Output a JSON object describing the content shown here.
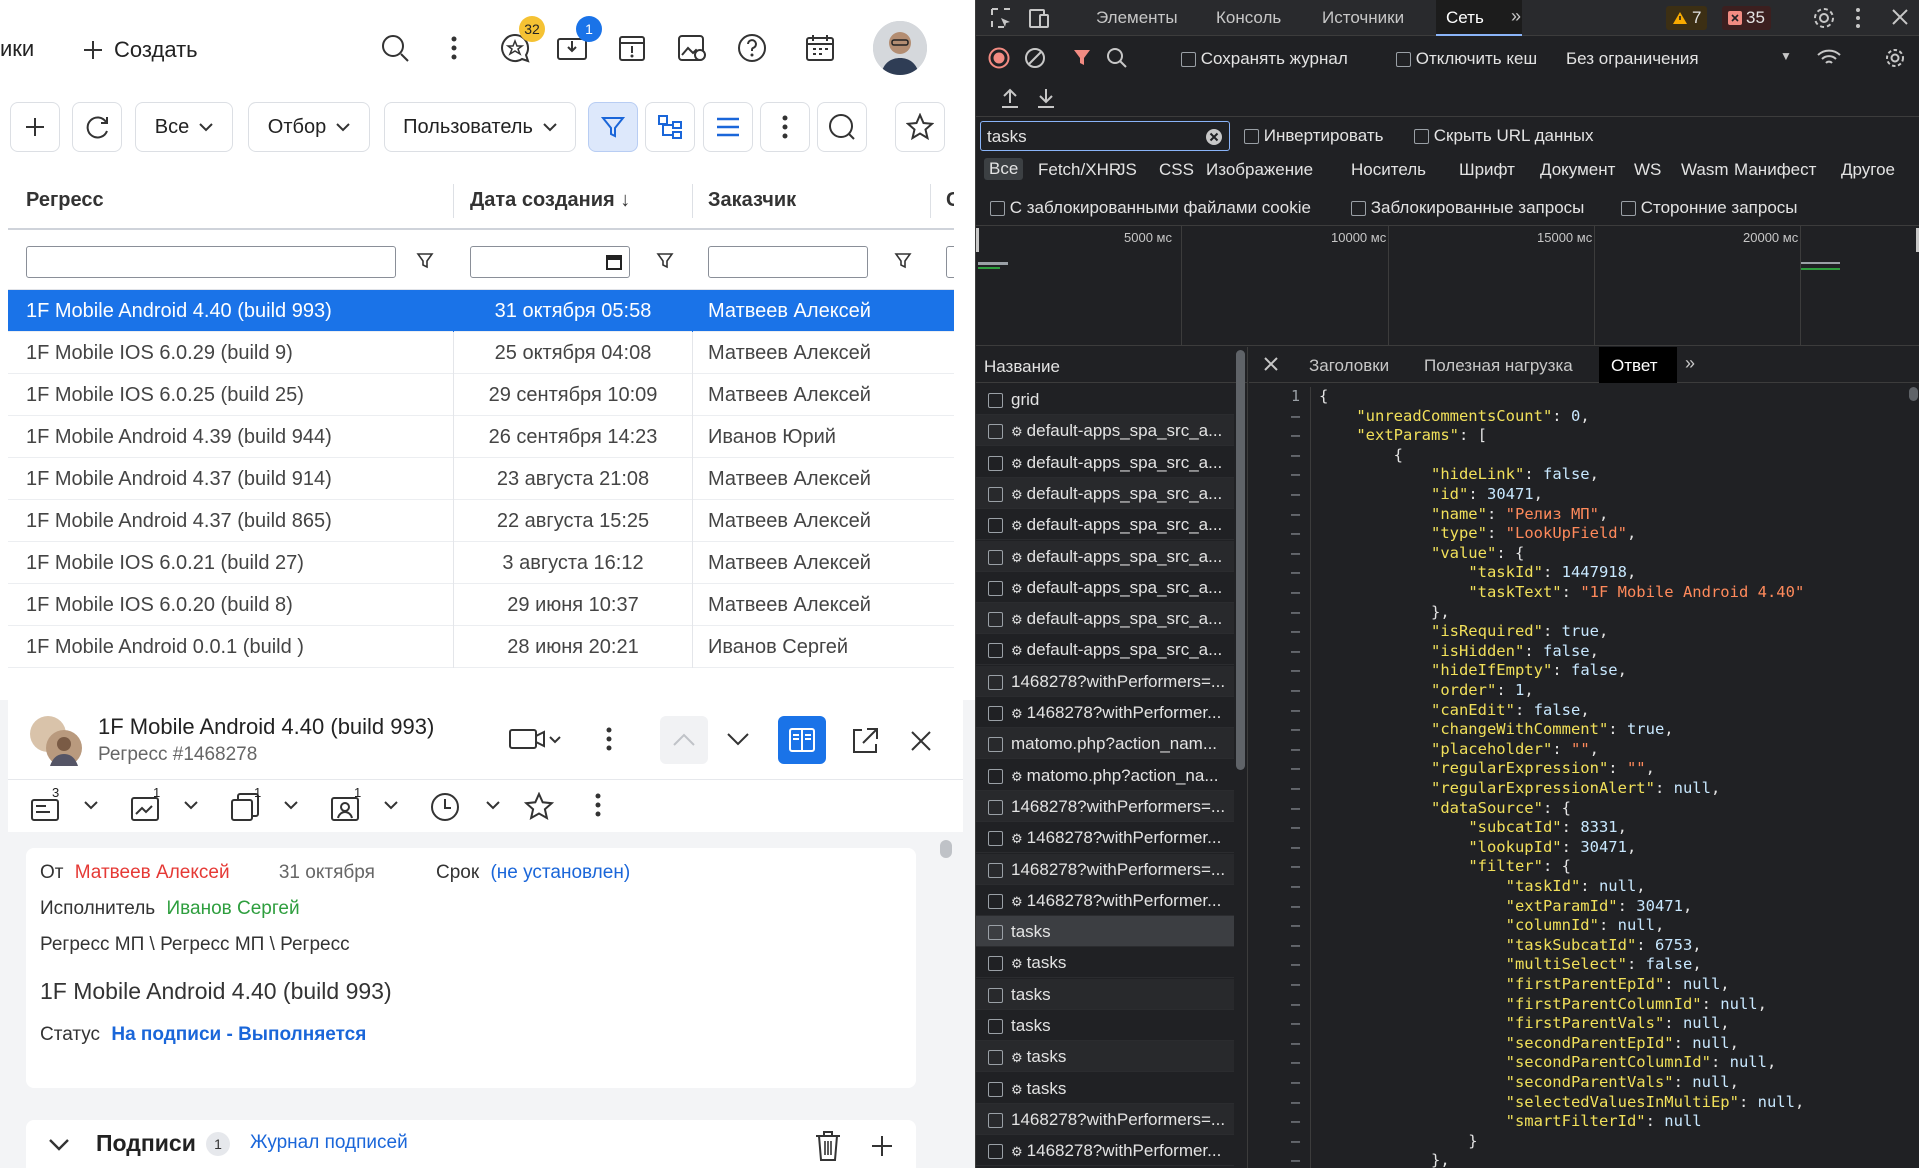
{
  "app": {
    "left_crumb": "ики",
    "create_label": "Создать",
    "badges": {
      "favorites": "32",
      "inbox": "1"
    },
    "toolbar": {
      "all_label": "Все",
      "filter_label": "Отбор",
      "user_label": "Пользователь"
    },
    "grid": {
      "columns": [
        "Регресс",
        "Дата создания",
        "Заказчик",
        "С"
      ],
      "sort_arrow": "↓",
      "rows": [
        {
          "name": "1F Mobile Android 4.40 (build 993)",
          "date": "31 октября 05:58",
          "customer": "Матвеев Алексей"
        },
        {
          "name": "1F Mobile IOS 6.0.29 (build 9)",
          "date": "25 октября 04:08",
          "customer": "Матвеев Алексей"
        },
        {
          "name": "1F Mobile IOS 6.0.25 (build 25)",
          "date": "29 сентября 10:09",
          "customer": "Матвеев Алексей"
        },
        {
          "name": "1F Mobile Android 4.39 (build 944)",
          "date": "26 сентября 14:23",
          "customer": "Иванов Юрий"
        },
        {
          "name": "1F Mobile Android 4.37 (build 914)",
          "date": "23 августа 21:08",
          "customer": "Матвеев Алексей"
        },
        {
          "name": "1F Mobile Android 4.37 (build 865)",
          "date": "22 августа 15:25",
          "customer": "Матвеев Алексей"
        },
        {
          "name": "1F Mobile IOS 6.0.21 (build 27)",
          "date": "3 августа 16:12",
          "customer": "Матвеев Алексей"
        },
        {
          "name": "1F Mobile IOS 6.0.20 (build 8)",
          "date": "29 июня 10:37",
          "customer": "Матвеев Алексей"
        },
        {
          "name": "1F Mobile Android 0.0.1 (build )",
          "date": "28 июня 20:21",
          "customer": "Иванов Сергей"
        }
      ]
    },
    "detail": {
      "title": "1F Mobile Android 4.40 (build 993)",
      "subtitle": "Регресс   #1468278",
      "counters": {
        "tasks": "3",
        "reports": "1",
        "copies": "1",
        "users": "1"
      },
      "from_label": "От",
      "from_name": "Матвеев Алексей",
      "from_date": "31 октября",
      "due_label": "Срок",
      "due_value": "(не установлен)",
      "executor_label": "Исполнитель",
      "executor_name": "Иванов Сергей",
      "path": "Регресс МП \\ Регресс МП \\ Регресс",
      "task_title": "1F Mobile Android 4.40 (build 993)",
      "status_label": "Статус",
      "status_value": "На подписи - Выполняется",
      "signatures_label": "Подписи",
      "signatures_count": "1",
      "signatures_log": "Журнал подписей"
    }
  },
  "devtools": {
    "tabs": [
      "Элементы",
      "Консоль",
      "Источники",
      "Сеть"
    ],
    "warnings": "7",
    "errors": "35",
    "preserve_log": "Сохранять журнал",
    "disable_cache": "Отключить кеш",
    "throttling": "Без ограничения",
    "filter_value": "tasks",
    "invert": "Инвертировать",
    "hide_data_urls": "Скрыть URL данных",
    "types": [
      "Все",
      "Fetch/XHR",
      "JS",
      "CSS",
      "Изображение",
      "Носитель",
      "Шрифт",
      "Документ",
      "WS",
      "Wasm",
      "Манифест",
      "Другое"
    ],
    "blocked_cookies": "С заблокированными файлами cookie",
    "blocked_requests": "Заблокированные запросы",
    "third_party": "Сторонние запросы",
    "timeline_labels": [
      "5000 мс",
      "10000 мс",
      "15000 мс",
      "20000 мс"
    ],
    "name_header": "Название",
    "requests": [
      "grid",
      "default-apps_spa_src_a...",
      "default-apps_spa_src_a...",
      "default-apps_spa_src_a...",
      "default-apps_spa_src_a...",
      "default-apps_spa_src_a...",
      "default-apps_spa_src_a...",
      "default-apps_spa_src_a...",
      "default-apps_spa_src_a...",
      "1468278?withPerformers=...",
      "1468278?withPerformer...",
      "matomo.php?action_nam...",
      "matomo.php?action_na...",
      "1468278?withPerformers=...",
      "1468278?withPerformer...",
      "1468278?withPerformers=...",
      "1468278?withPerformer...",
      "tasks",
      "tasks",
      "tasks",
      "tasks",
      "tasks",
      "tasks",
      "1468278?withPerformers=...",
      "1468278?withPerformer..."
    ],
    "request_gear": [
      false,
      true,
      true,
      true,
      true,
      true,
      true,
      true,
      true,
      false,
      true,
      false,
      true,
      false,
      true,
      false,
      true,
      false,
      true,
      false,
      false,
      true,
      true,
      false,
      true
    ],
    "detail_tabs": [
      "Заголовки",
      "Полезная нагрузка",
      "Ответ"
    ],
    "response_lines": [
      "{",
      "    \"unreadCommentsCount\": 0,",
      "    \"extParams\": [",
      "        {",
      "            \"hideLink\": false,",
      "            \"id\": 30471,",
      "            \"name\": \"Релиз МП\",",
      "            \"type\": \"LookUpField\",",
      "            \"value\": {",
      "                \"taskId\": 1447918,",
      "                \"taskText\": \"1F Mobile Android 4.40\"",
      "            },",
      "            \"isRequired\": true,",
      "            \"isHidden\": false,",
      "            \"hideIfEmpty\": false,",
      "            \"order\": 1,",
      "            \"canEdit\": false,",
      "            \"changeWithComment\": true,",
      "            \"placeholder\": \"\",",
      "            \"regularExpression\": \"\",",
      "            \"regularExpressionAlert\": null,",
      "            \"dataSource\": {",
      "                \"subcatId\": 8331,",
      "                \"lookupId\": 30471,",
      "                \"filter\": {",
      "                    \"taskId\": null,",
      "                    \"extParamId\": 30471,",
      "                    \"columnId\": null,",
      "                    \"taskSubcatId\": 6753,",
      "                    \"multiSelect\": false,",
      "                    \"firstParentEpId\": null,",
      "                    \"firstParentColumnId\": null,",
      "                    \"firstParentVals\": null,",
      "                    \"secondParentEpId\": null,",
      "                    \"secondParentColumnId\": null,",
      "                    \"secondParentVals\": null,",
      "                    \"selectedValuesInMultiEp\": null,",
      "                    \"smartFilterId\": null",
      "                }",
      "            },"
    ]
  }
}
